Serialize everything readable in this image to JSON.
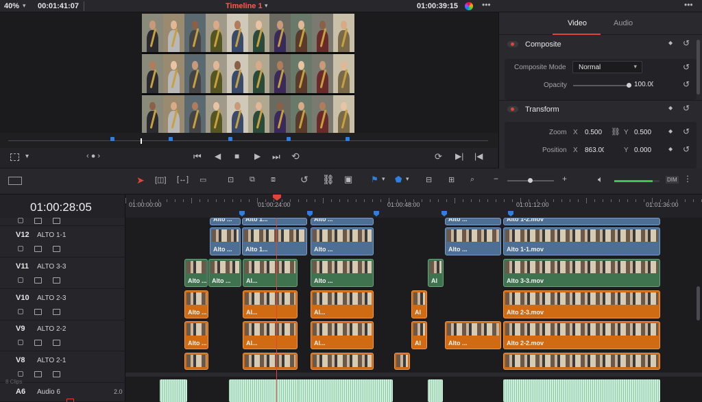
{
  "topbar": {
    "zoom": "40%",
    "source_timecode": "00:01:41:07",
    "timeline_name": "Timeline 1",
    "record_timecode": "01:00:39:15"
  },
  "inspector": {
    "tabs": [
      "Video",
      "Audio"
    ],
    "active_tab": "Video",
    "composite": {
      "title": "Composite",
      "mode_label": "Composite Mode",
      "mode_value": "Normal",
      "opacity_label": "Opacity",
      "opacity_value": "100.00",
      "opacity_level": 1.0
    },
    "transform": {
      "title": "Transform",
      "zoom_label": "Zoom",
      "zoom_x": "0.500",
      "zoom_y": "0.500",
      "position_label": "Position",
      "position_x": "863.00",
      "position_y": "0.000",
      "x_label": "X",
      "y_label": "Y"
    }
  },
  "timeline": {
    "current_timecode": "01:00:28:05",
    "ruler_labels": [
      "01:00:00:00",
      "01:00:24:00",
      "01:00:48:00",
      "01:01:12:00",
      "01:01:36:00"
    ],
    "tracks": [
      {
        "id": "V12",
        "name": "ALTO 1-1"
      },
      {
        "id": "V11",
        "name": "ALTO 3-3"
      },
      {
        "id": "V10",
        "name": "ALTO 2-3"
      },
      {
        "id": "V9",
        "name": "ALTO 2-2"
      },
      {
        "id": "V8",
        "name": "ALTO 2-1"
      }
    ],
    "audio_track": {
      "id": "A6",
      "name": "Audio 6",
      "channels": "2.0"
    },
    "clips_label": "8 Clips",
    "clip_labels": {
      "alto_short": "Alto ...",
      "al_short": "Al...",
      "a_short": "Al",
      "alto_1_1": "Alto 1-1.mov",
      "alto_1_2": "Alto 1-2.mov",
      "alto_3_3": "Alto 3-3.mov",
      "alto_2_3": "Alto 2-3.mov",
      "alto_2_2": "Alto 2-2.mov",
      "alto1_dots": "Alto 1...",
      "alto_dots": "Alto ..."
    },
    "audio_level": 0.85
  },
  "colors": {
    "accent_red": "#e0453a",
    "clip_blue": "#4d6f93",
    "clip_green": "#3f7350",
    "clip_orange": "#d06b13",
    "marker_blue": "#2f7fe0"
  },
  "icons": [
    "chevron-down-icon",
    "color-wheel-icon",
    "more-icon",
    "skip-back-icon",
    "step-back-icon",
    "stop-icon",
    "play-icon",
    "skip-forward-icon",
    "loop-icon",
    "select-arrow-icon",
    "link-icon",
    "snap-icon",
    "flag-icon",
    "speaker-icon",
    "lock-icon",
    "reset-icon",
    "keyframe-icon"
  ],
  "audio_meter_label": "DIM"
}
